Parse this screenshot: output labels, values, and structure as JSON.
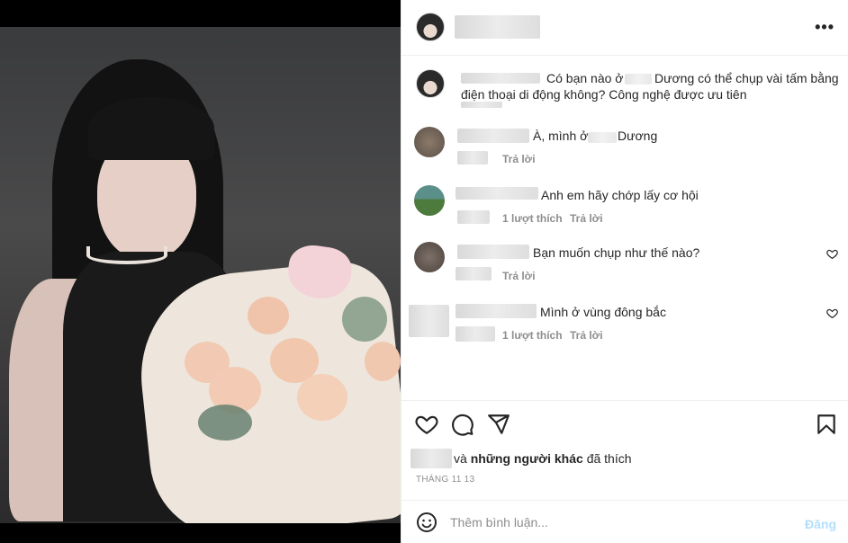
{
  "post": {
    "username": "",
    "icons": {
      "more": "more-options-icon",
      "like": "heart-icon",
      "comment": "comment-icon",
      "share": "share-icon",
      "save": "bookmark-icon",
      "emoji": "emoji-icon"
    }
  },
  "caption": {
    "line1": "Có bạn nào ở",
    "line1b": "Dương có thể chụp vài tấm bằng",
    "line2": "điện thoại di động không? Công nghệ được ưu tiên"
  },
  "comments": [
    {
      "text_a": "À, mình ở",
      "text_b": "Dương",
      "likes": "",
      "reply": "Trả lời",
      "has_heart": false
    },
    {
      "text_a": "Anh em hãy chớp lấy cơ hội",
      "text_b": "",
      "likes": "1 lượt thích",
      "reply": "Trả lời",
      "has_heart": false
    },
    {
      "text_a": "Bạn muốn chụp như thế nào?",
      "text_b": "",
      "likes": "",
      "reply": "Trả lời",
      "has_heart": true
    },
    {
      "text_a": "Mình ở vùng đông bắc",
      "text_b": "",
      "likes": "1 lượt thích",
      "reply": "Trả lời",
      "has_heart": true
    }
  ],
  "likes_line": {
    "suffix_pre": "và",
    "bold": "những người khác",
    "suffix_post": "đã thích"
  },
  "date": "THÁNG 11 13",
  "add_comment": {
    "placeholder": "Thêm bình luận...",
    "post_label": "Đăng"
  },
  "colors": {
    "accent_disabled": "#b2dffc",
    "muted": "#8e8e8e",
    "text": "#262626",
    "border": "#efefef"
  }
}
